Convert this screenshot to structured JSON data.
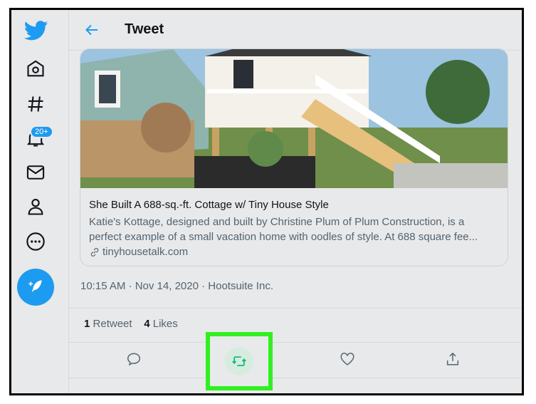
{
  "header": {
    "title": "Tweet"
  },
  "sidebar": {
    "notifications_badge": "20+"
  },
  "card": {
    "title": "She Built A 688-sq.-ft. Cottage w/ Tiny House Style",
    "description_line1": "Katie's Kottage, designed and built by Christine Plum of Plum Construction, is a",
    "description_line2": "perfect example of a small vacation home with oodles of style. At 688 square fee...",
    "link": "tinyhousetalk.com"
  },
  "tweet": {
    "timestamp": "10:15 AM · Nov 14, 2020 · Hootsuite Inc."
  },
  "stats": {
    "retweet_count": "1",
    "retweet_label": "Retweet",
    "like_count": "4",
    "like_label": "Likes"
  },
  "colors": {
    "accent": "#1d9bf0",
    "retweet_green": "#00ba7c",
    "highlight_green": "#30f020"
  }
}
